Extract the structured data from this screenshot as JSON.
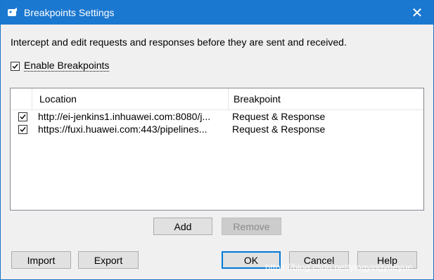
{
  "window": {
    "title": "Breakpoints Settings",
    "close_glyph": "✕"
  },
  "description": "Intercept and edit requests and responses before they are sent and received.",
  "enable_breakpoints": {
    "label": "Enable Breakpoints",
    "checked": true
  },
  "table": {
    "columns": [
      "Location",
      "Breakpoint"
    ],
    "rows": [
      {
        "checked": true,
        "location": "http://ei-jenkins1.inhuawei.com:8080/j...",
        "breakpoint": "Request & Response"
      },
      {
        "checked": true,
        "location": "https://fuxi.huawei.com:443/pipelines...",
        "breakpoint": "Request & Response"
      }
    ]
  },
  "buttons": {
    "add": "Add",
    "remove": "Remove",
    "import": "Import",
    "export": "Export",
    "ok": "OK",
    "cancel": "Cancel",
    "help": "Help"
  },
  "watermark": "https://blog.csdn.net/yingyingyueyue",
  "colors": {
    "titlebar": "#1b78d0",
    "dialog_bg": "#f0f0f0",
    "default_button_border": "#0078d7"
  }
}
